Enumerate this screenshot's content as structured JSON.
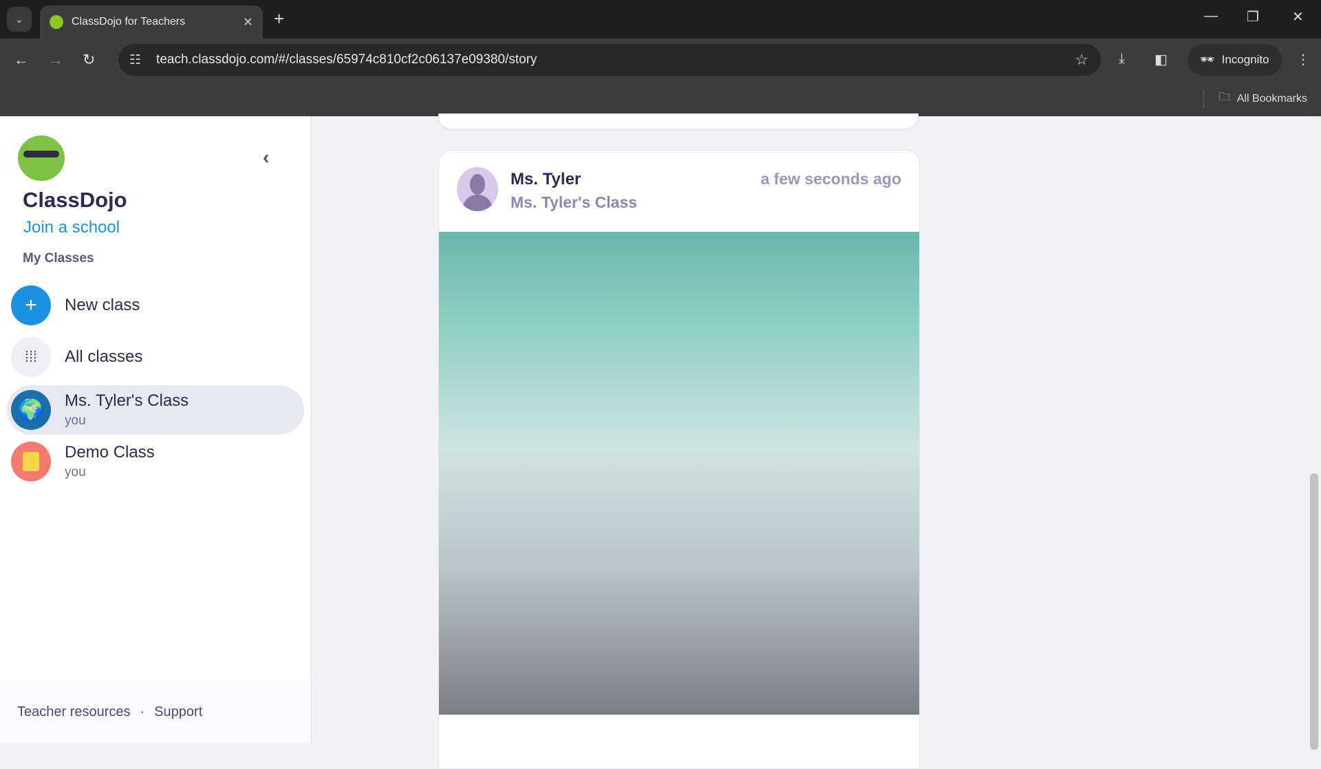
{
  "browser": {
    "tab_title": "ClassDojo for Teachers",
    "url": "teach.classdojo.com/#/classes/65974c810cf2c06137e09380/story",
    "incognito": "Incognito",
    "all_bookmarks": "All Bookmarks"
  },
  "sidebar": {
    "brand": "ClassDojo",
    "join": "Join a school",
    "my_classes": "My Classes",
    "new_class": "New class",
    "all_classes": "All classes",
    "classes": [
      {
        "name": "Ms. Tyler's Class",
        "sub": "you",
        "color": "#1b6fa8"
      },
      {
        "name": "Demo Class",
        "sub": "you",
        "color": "#f37a6e"
      }
    ],
    "footer": {
      "resources": "Teacher resources",
      "sep": "·",
      "support": "Support"
    }
  },
  "post": {
    "author": "Ms. Tyler",
    "class": "Ms. Tyler's Class",
    "time": "a few seconds ago"
  }
}
